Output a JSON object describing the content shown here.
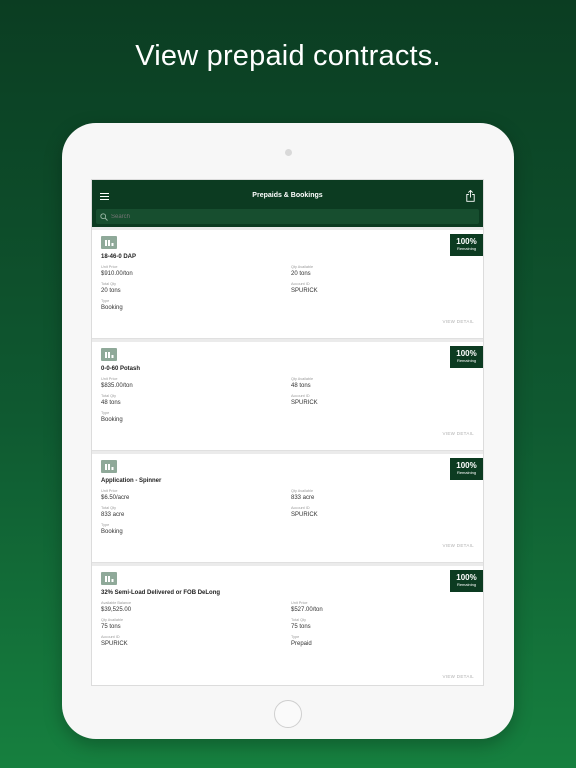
{
  "headline": "View prepaid contracts.",
  "navbar": {
    "title": "Prepaids & Bookings",
    "search_placeholder": "Search"
  },
  "cards": [
    {
      "title": "18-46-0 DAP",
      "badge_pct": "100%",
      "badge_label": "Remaining",
      "fields": [
        {
          "label": "Unit Price",
          "value": "$910.00/ton"
        },
        {
          "label": "Qty Available",
          "value": "20 tons"
        },
        {
          "label": "Total Qty",
          "value": "20 tons"
        },
        {
          "label": "Account ID",
          "value": "SPURICK"
        },
        {
          "label": "Type",
          "value": "Booking"
        }
      ],
      "link": "VIEW DETAIL"
    },
    {
      "title": "0-0-60 Potash",
      "badge_pct": "100%",
      "badge_label": "Remaining",
      "fields": [
        {
          "label": "Unit Price",
          "value": "$835.00/ton"
        },
        {
          "label": "Qty Available",
          "value": "48 tons"
        },
        {
          "label": "Total Qty",
          "value": "48 tons"
        },
        {
          "label": "Account ID",
          "value": "SPURICK"
        },
        {
          "label": "Type",
          "value": "Booking"
        }
      ],
      "link": "VIEW DETAIL"
    },
    {
      "title": "Application - Spinner",
      "badge_pct": "100%",
      "badge_label": "Remaining",
      "fields": [
        {
          "label": "Unit Price",
          "value": "$6.50/acre"
        },
        {
          "label": "Qty Available",
          "value": "833 acre"
        },
        {
          "label": "Total Qty",
          "value": "833 acre"
        },
        {
          "label": "Account ID",
          "value": "SPURICK"
        },
        {
          "label": "Type",
          "value": "Booking"
        }
      ],
      "link": "VIEW DETAIL"
    },
    {
      "title": "32% Semi-Load Delivered or FOB DeLong",
      "badge_pct": "100%",
      "badge_label": "Remaining",
      "fields": [
        {
          "label": "Available Balance",
          "value": "$39,525.00"
        },
        {
          "label": "Unit Price",
          "value": "$527.00/ton"
        },
        {
          "label": "Qty Available",
          "value": "75 tons"
        },
        {
          "label": "Total Qty",
          "value": "75 tons"
        },
        {
          "label": "Account ID",
          "value": "SPURICK"
        },
        {
          "label": "Type",
          "value": "Prepaid"
        }
      ],
      "link": "VIEW DETAIL"
    }
  ],
  "icons": {
    "menu": "menu-icon",
    "share": "share-icon",
    "search": "search-icon",
    "product": "fertilizer-icon"
  },
  "colors": {
    "brand_dark_green": "#0c3b21",
    "background_gradient_top": "#0b3d22",
    "background_gradient_bottom": "#16803f"
  }
}
